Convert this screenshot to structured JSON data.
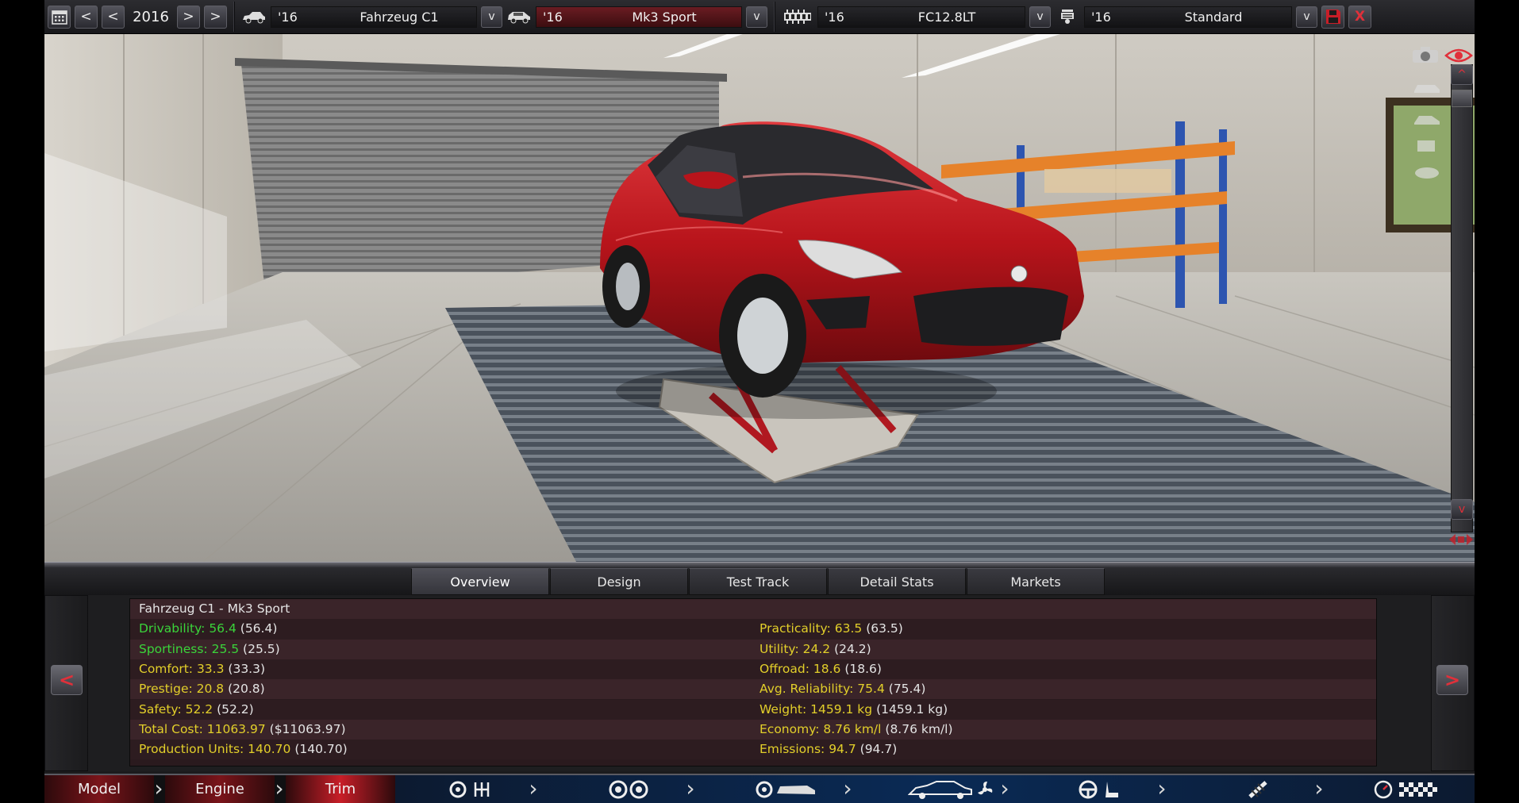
{
  "topbar": {
    "year": "2016",
    "calendar_icon": "calendar-icon",
    "nav_prev_fast": "<",
    "nav_prev": "<",
    "nav_next": ">",
    "nav_next_fast": ">",
    "model": {
      "year": "'16",
      "name": "Fahrzeug C1",
      "icon": "car-model-icon"
    },
    "trim": {
      "year": "'16",
      "name": "Mk3 Sport",
      "icon": "car-trim-icon"
    },
    "engine": {
      "year": "'16",
      "name": "FC12.8LT",
      "icon": "engine-icon"
    },
    "family": {
      "year": "'16",
      "name": "Standard",
      "icon": "piston-icon"
    },
    "dropdown": "v",
    "save_icon": "save-icon",
    "close_label": "X"
  },
  "viewport": {
    "scroll_up": "^",
    "scroll_down": "v",
    "tool_icons": [
      "camera-icon",
      "eye-icon",
      "car-view-icon-1",
      "car-view-icon-2",
      "car-view-icon-3",
      "car-view-icon-4"
    ]
  },
  "tabs": [
    {
      "label": "Overview",
      "active": true
    },
    {
      "label": "Design",
      "active": false
    },
    {
      "label": "Test Track",
      "active": false
    },
    {
      "label": "Detail Stats",
      "active": false
    },
    {
      "label": "Markets",
      "active": false
    }
  ],
  "stats": {
    "title": "Fahrzeug C1 - Mk3 Sport",
    "left": [
      {
        "label": "Drivability: 56.4",
        "prev": "(56.4)",
        "color": "#3ad43a"
      },
      {
        "label": "Sportiness: 25.5",
        "prev": "(25.5)",
        "color": "#3ad43a"
      },
      {
        "label": "Comfort: 33.3",
        "prev": "(33.3)",
        "color": "#e2cf2a"
      },
      {
        "label": "Prestige: 20.8",
        "prev": "(20.8)",
        "color": "#e2cf2a"
      },
      {
        "label": "Safety: 52.2",
        "prev": "(52.2)",
        "color": "#e2cf2a"
      },
      {
        "label": "Total Cost: 11063.97",
        "prev": "($11063.97)",
        "color": "#e2cf2a"
      },
      {
        "label": "Production Units: 140.70",
        "prev": "(140.70)",
        "color": "#e2cf2a"
      }
    ],
    "right": [
      {
        "label": "Practicality: 63.5",
        "prev": "(63.5)",
        "color": "#e2cf2a"
      },
      {
        "label": "Utility: 24.2",
        "prev": "(24.2)",
        "color": "#e2cf2a"
      },
      {
        "label": "Offroad: 18.6",
        "prev": "(18.6)",
        "color": "#e2cf2a"
      },
      {
        "label": "Avg. Reliability: 75.4",
        "prev": "(75.4)",
        "color": "#e2cf2a"
      },
      {
        "label": "Weight: 1459.1 kg",
        "prev": "(1459.1 kg)",
        "color": "#e2cf2a"
      },
      {
        "label": "Economy: 8.76 km/l",
        "prev": "(8.76 km/l)",
        "color": "#e2cf2a"
      },
      {
        "label": "Emissions: 94.7",
        "prev": "(94.7)",
        "color": "#e2cf2a"
      }
    ],
    "prev_arrow": "<",
    "next_arrow": ">"
  },
  "bottom_nav": {
    "model": "Model",
    "engine": "Engine",
    "trim": "Trim",
    "icons": [
      "gearbox-icon",
      "wheels-icon",
      "brakes-body-icon",
      "car-fan-icon",
      "interior-icon",
      "suspension-icon",
      "test-drive-icon"
    ]
  },
  "colors": {
    "accent_red": "#c81e28",
    "good": "#3ad43a",
    "neutral": "#e2cf2a"
  }
}
